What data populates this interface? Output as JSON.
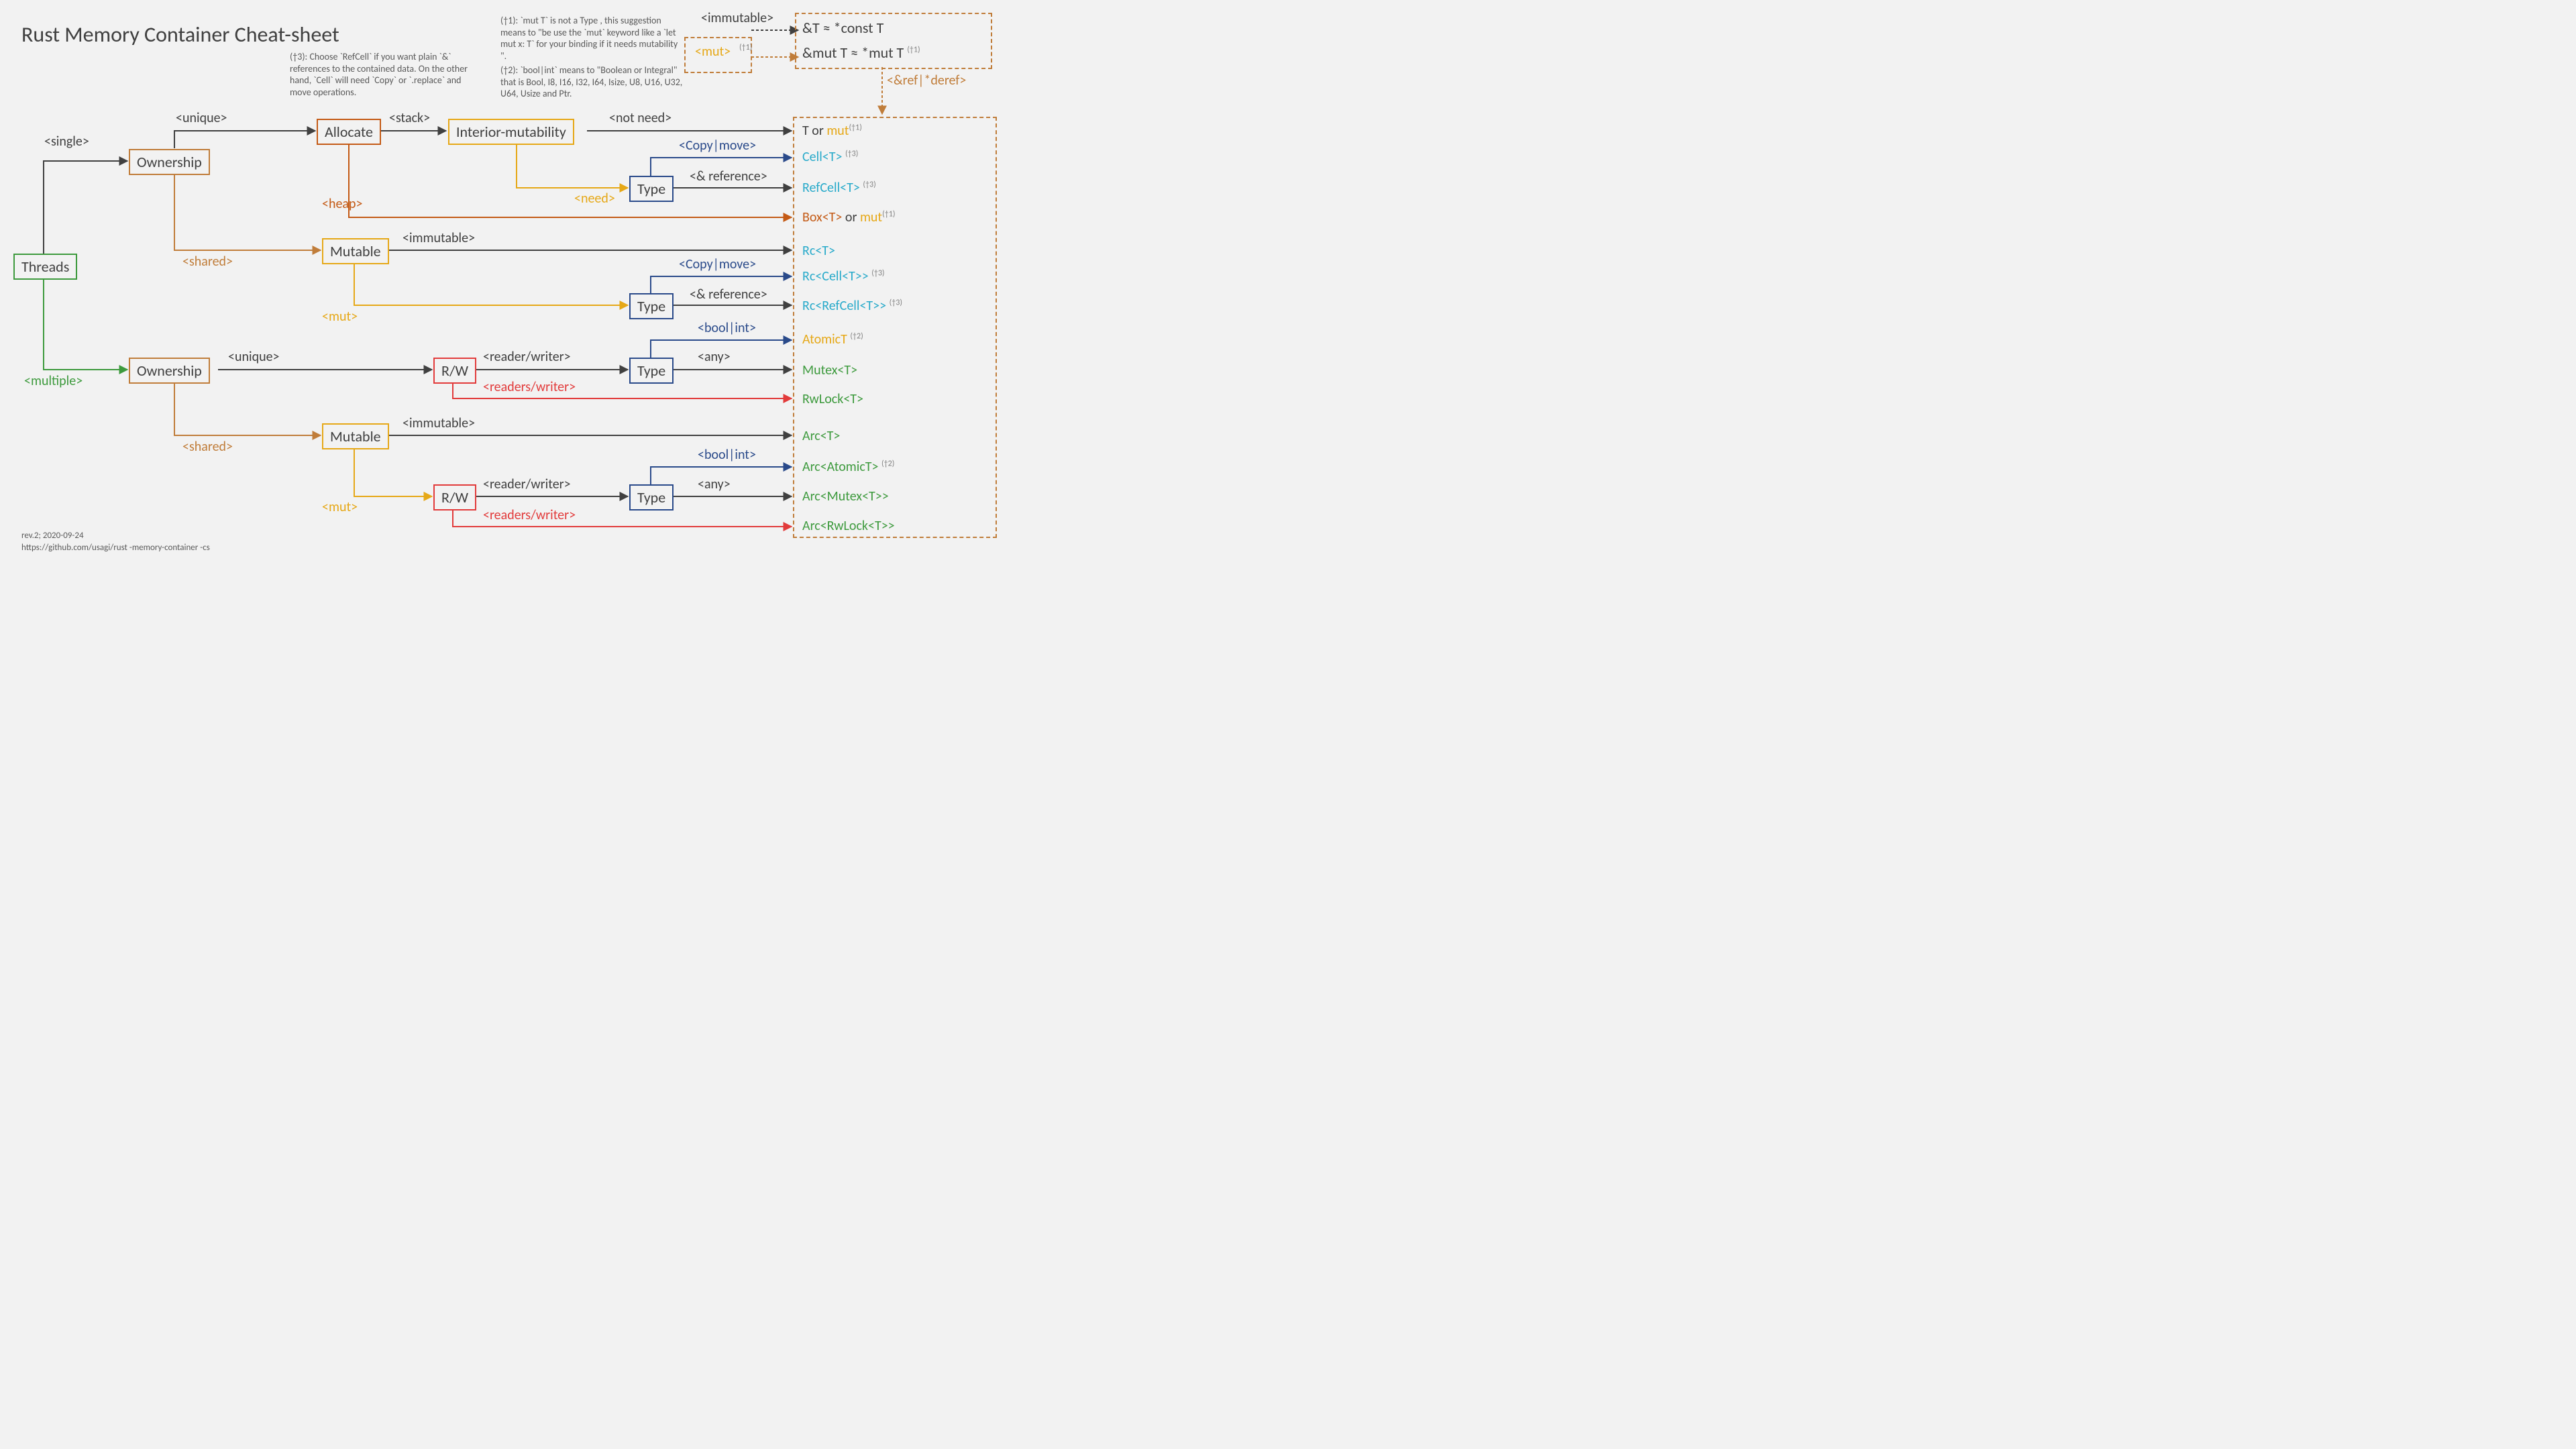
{
  "title": "Rust Memory Container Cheat-sheet",
  "footnotes": {
    "t1": "(†1): `mut T` is not a Type , this suggestion means to \"be use the `mut` keyword like a `let  mut x: T` for your binding if it needs mutability \".",
    "t2": "(†2): `bool|int` means to \"Boolean or Integral\" that is Bool, I8, I16, I32, I64, Isize, U8, U16, U32, U64,  Usize and Ptr.",
    "t3": "(†3): Choose `RefCell` if you want plain `&` references to the contained data. On the other hand, `Cell` will need `Copy` or `.replace` and move operations."
  },
  "footer": {
    "rev": "rev.2; 2020-09-24",
    "url": "https://github.com/usagi/rust -memory-container -cs"
  },
  "nodes": {
    "threads": "Threads",
    "ownership1": "Ownership",
    "ownership2": "Ownership",
    "allocate": "Allocate",
    "mutable1": "Mutable",
    "mutable2": "Mutable",
    "interior": "Interior-mutability",
    "type1": "Type",
    "type2": "Type",
    "type3": "Type",
    "type4": "Type",
    "rw1": "R/W",
    "rw2": "R/W"
  },
  "edges": {
    "single": "<single>",
    "multiple": "<multiple>",
    "unique1": "<unique>",
    "unique2": "<unique>",
    "shared1": "<shared>",
    "shared2": "<shared>",
    "stack": "<stack>",
    "heap": "<heap>",
    "immutable1": "<immutable>",
    "immutable2": "<immutable>",
    "immutable_top": "<immutable>",
    "mut1": "<mut>",
    "mut2": "<mut>",
    "mut_top": "<mut>",
    "need": "<need>",
    "notneed": "<not need>",
    "copymove1": "<Copy|move>",
    "copymove2": "<Copy|move>",
    "ref1": "<& reference>",
    "ref2": "<& reference>",
    "readerwriter1": "<reader/writer>",
    "readerwriter2": "<reader/writer>",
    "readerswriter1": "<readers/writer>",
    "readerswriter2": "<readers/writer>",
    "boolint1": "<bool|int>",
    "boolint2": "<bool|int>",
    "any1": "<any>",
    "any2": "<any>",
    "refderef": "<&ref|*deref>"
  },
  "results": {
    "const_t": "&T ≈ *const T",
    "mut_t": "&mut T ≈ *mut T",
    "t_or_mut": "T",
    "t_or_mut_suffix": " or ",
    "t_or_mut_mut": "mut",
    "cell": "Cell<T>",
    "refcell": "RefCell<T>",
    "box": "Box<T>",
    "box_suffix": " or ",
    "box_mut": "mut",
    "rc": "Rc<T>",
    "rc_cell": "Rc<Cell<T>>",
    "rc_refcell": "Rc<RefCell<T>>",
    "atomic": "AtomicT",
    "mutex": "Mutex<T>",
    "rwlock": "RwLock<T>",
    "arc": "Arc<T>",
    "arc_atomic": "Arc<AtomicT>",
    "arc_mutex": "Arc<Mutex<T>>",
    "arc_rwlock": "Arc<RwLock<T>>"
  },
  "sup": {
    "t1": "(†1)",
    "t2": "(†2)",
    "t3": "(†3)"
  }
}
